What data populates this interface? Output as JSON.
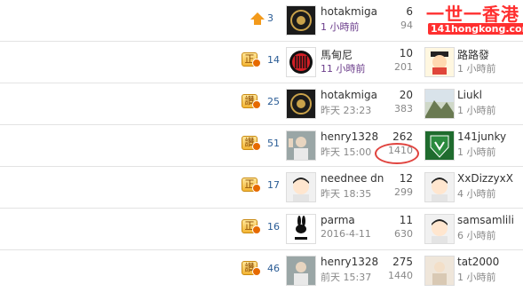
{
  "watermark": {
    "line1": "一世一香港",
    "line2": "141hongkong.com"
  },
  "rows": [
    {
      "tag_type": "up",
      "tag": "",
      "rank": "3",
      "starter": "hotakmiga",
      "started": "1 小時前",
      "started_purple": true,
      "replies": "6",
      "views": "94",
      "last_user": "",
      "last_time": ""
    },
    {
      "tag_type": "tag",
      "tag": "正",
      "rank": "14",
      "starter": "馬甸尼",
      "started": "11 小時前",
      "started_purple": true,
      "replies": "10",
      "views": "201",
      "last_user": "路路發",
      "last_time": "1 小時前"
    },
    {
      "tag_type": "tag",
      "tag": "讚",
      "rank": "25",
      "starter": "hotakmiga",
      "started": "昨天 23:23",
      "started_purple": false,
      "replies": "20",
      "views": "383",
      "last_user": "Liukl",
      "last_time": "1 小時前"
    },
    {
      "tag_type": "tag",
      "tag": "讚",
      "rank": "51",
      "starter": "henry1328",
      "started": "昨天 15:00",
      "started_purple": false,
      "replies": "262",
      "views": "1410",
      "last_user": "141junky",
      "last_time": "1 小時前"
    },
    {
      "tag_type": "tag",
      "tag": "正",
      "rank": "17",
      "starter": "neednee dn",
      "started": "昨天 18:35",
      "started_purple": false,
      "replies": "12",
      "views": "299",
      "last_user": "XxDizzyxX",
      "last_time": "4 小時前"
    },
    {
      "tag_type": "tag",
      "tag": "正",
      "rank": "16",
      "starter": "parma",
      "started": "2016-4-11",
      "started_purple": false,
      "replies": "11",
      "views": "630",
      "last_user": "samsamlili",
      "last_time": "6 小時前"
    },
    {
      "tag_type": "tag",
      "tag": "讚",
      "rank": "46",
      "starter": "henry1328",
      "started": "前天 15:37",
      "started_purple": false,
      "replies": "275",
      "views": "1440",
      "last_user": "tat2000",
      "last_time": "1 小時前"
    }
  ]
}
